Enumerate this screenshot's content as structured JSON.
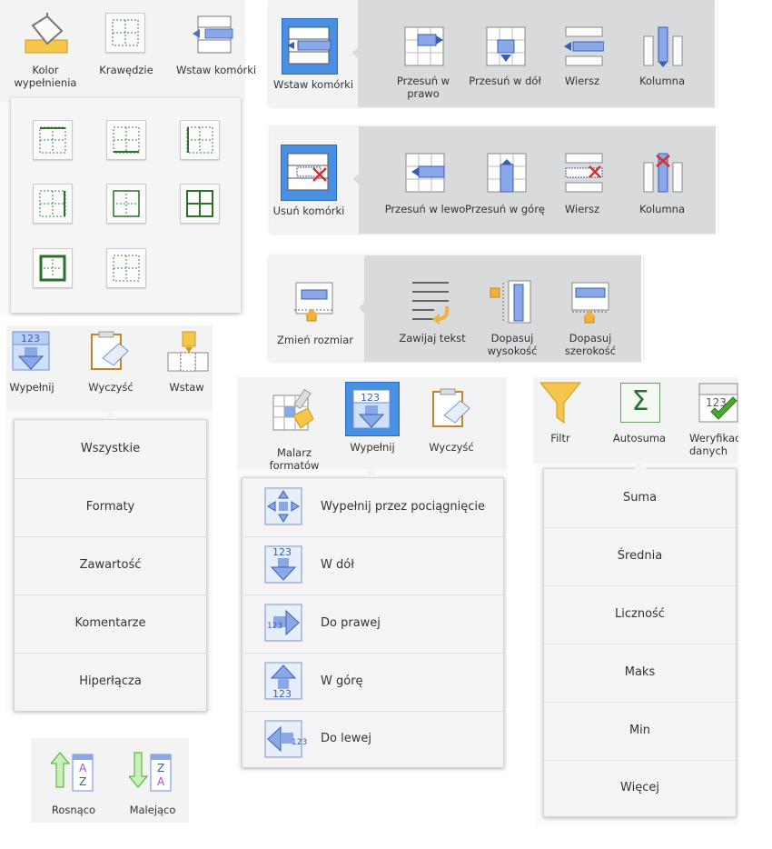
{
  "top_left": {
    "fill_color_label": "Kolor\nwypełnienia",
    "borders_label": "Krawędzie",
    "insert_cells_label": "Wstaw komórki"
  },
  "insert_cells_panel": {
    "main_label": "Wstaw komórki",
    "items": [
      "Przesuń w\nprawo",
      "Przesuń w dół",
      "Wiersz",
      "Kolumna"
    ]
  },
  "delete_cells_panel": {
    "main_label": "Usuń komórki",
    "items": [
      "Przesuń w lewo",
      "Przesuń w górę",
      "Wiersz",
      "Kolumna"
    ]
  },
  "resize_panel": {
    "main_label": "Zmień rozmiar",
    "items": [
      "Zawijaj tekst",
      "Dopasuj\nwysokość",
      "Dopasuj\nszerokość"
    ]
  },
  "clear_toolbar": {
    "fill_label": "Wypełnij",
    "clear_label": "Wyczyść",
    "insert_label": "Wstaw",
    "badge": "123"
  },
  "clear_menu": [
    "Wszystkie",
    "Formaty",
    "Zawartość",
    "Komentarze",
    "Hiperłącza"
  ],
  "fill_toolbar": {
    "painter_label": "Malarz\nformatów",
    "fill_label": "Wypełnij",
    "clear_label": "Wyczyść",
    "badge": "123"
  },
  "fill_menu": [
    "Wypełnij przez pociągnięcie",
    "W dół",
    "Do prawej",
    "W górę",
    "Do lewej"
  ],
  "autosum_toolbar": {
    "filter_label": "Filtr",
    "autosum_label": "Autosuma",
    "validation_label": "Weryfikacja\ndanych",
    "badge": "123"
  },
  "autosum_menu": [
    "Suma",
    "Średnia",
    "Liczność",
    "Maks",
    "Min",
    "Więcej"
  ],
  "sort_panel": {
    "asc_label": "Rosnąco",
    "desc_label": "Malejąco",
    "letter_a": "A",
    "letter_z": "Z"
  }
}
